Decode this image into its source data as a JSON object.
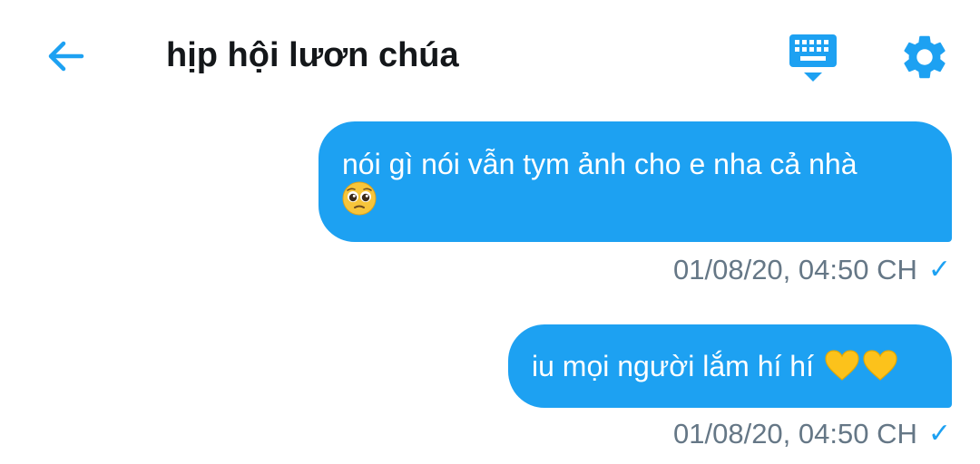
{
  "header": {
    "title": "hịp hội lươn chúa",
    "back_icon": "arrow-left-icon",
    "keyboard_icon": "keyboard-icon",
    "settings_icon": "gear-icon"
  },
  "colors": {
    "accent": "#1da1f2",
    "title_text": "#14171a",
    "meta_text": "#657786",
    "bubble_text": "#ffffff"
  },
  "messages": [
    {
      "text": "nói gì nói vẫn tym ảnh cho e nha cả nhà",
      "emoji": "🥺",
      "timestamp": "01/08/20, 04:50 CH",
      "status_icon": "checkmark-icon"
    },
    {
      "text": "iu mọi người lắm hí hí",
      "emoji": "💛💛",
      "timestamp": "01/08/20, 04:50 CH",
      "status_icon": "checkmark-icon"
    }
  ]
}
